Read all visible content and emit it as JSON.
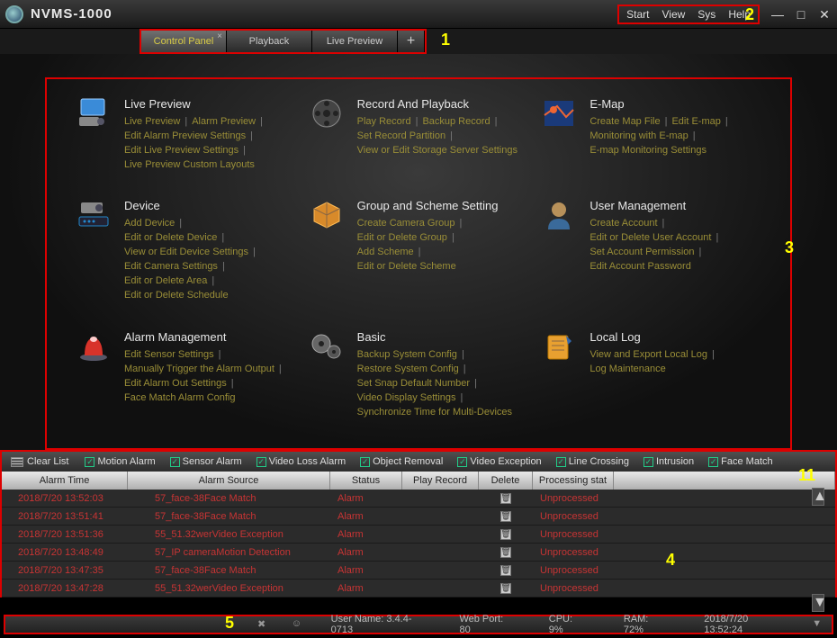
{
  "app_title": "NVMS-1000",
  "top_menu": {
    "start": "Start",
    "view": "View",
    "sys": "Sys",
    "help": "Help"
  },
  "tabs": [
    {
      "label": "Control Panel",
      "active": true,
      "closable": true
    },
    {
      "label": "Playback",
      "active": false,
      "closable": false
    },
    {
      "label": "Live Preview",
      "active": false,
      "closable": false
    }
  ],
  "annots": {
    "a1": "1",
    "a2": "2",
    "a3": "3",
    "a4": "4",
    "a5": "5",
    "a11": "11"
  },
  "modules": {
    "live_preview": {
      "title": "Live Preview",
      "links": [
        "Live Preview",
        "Alarm Preview",
        "Edit Alarm Preview Settings",
        "Edit Live Preview Settings",
        "Live Preview Custom Layouts"
      ]
    },
    "record_playback": {
      "title": "Record And Playback",
      "links": [
        "Play Record",
        "Backup Record",
        "Set Record Partition",
        "View or Edit Storage Server Settings"
      ]
    },
    "emap": {
      "title": "E-Map",
      "links": [
        "Create Map File",
        "Edit E-map",
        "Monitoring with E-map",
        "E-map Monitoring Settings"
      ]
    },
    "device": {
      "title": "Device",
      "links": [
        "Add Device",
        "Edit or Delete Device",
        "View or Edit Device Settings",
        "Edit Camera Settings",
        "Edit or Delete Area",
        "Edit or Delete Schedule"
      ]
    },
    "group_scheme": {
      "title": "Group and Scheme Setting",
      "links": [
        "Create Camera Group",
        "Edit or Delete Group",
        "Add Scheme",
        "Edit or Delete Scheme"
      ]
    },
    "user_mgmt": {
      "title": "User Management",
      "links": [
        "Create Account",
        "Edit or Delete User Account",
        "Set Account Permission",
        "Edit Account Password"
      ]
    },
    "alarm_mgmt": {
      "title": "Alarm Management",
      "links": [
        "Edit Sensor Settings",
        "Manually Trigger the Alarm Output",
        "Edit Alarm Out Settings",
        "Face Match Alarm Config"
      ]
    },
    "basic": {
      "title": "Basic",
      "links": [
        "Backup System Config",
        "Restore System Config",
        "Set Snap Default Number",
        "Video Display Settings",
        "Synchronize Time for Multi-Devices"
      ]
    },
    "local_log": {
      "title": "Local Log",
      "links": [
        "View and Export Local Log",
        "Log Maintenance"
      ]
    }
  },
  "alarm_filters": {
    "clear": "Clear List",
    "items": [
      "Motion Alarm",
      "Sensor Alarm",
      "Video Loss Alarm",
      "Object Removal",
      "Video Exception",
      "Line Crossing",
      "Intrusion",
      "Face Match"
    ]
  },
  "table": {
    "headers": {
      "time": "Alarm Time",
      "source": "Alarm Source",
      "status": "Status",
      "play": "Play Record",
      "del": "Delete",
      "proc": "Processing stat"
    },
    "rows": [
      {
        "time": "2018/7/20 13:52:03",
        "source": "57_face-38Face Match",
        "status": "Alarm",
        "proc": "Unprocessed"
      },
      {
        "time": "2018/7/20 13:51:41",
        "source": "57_face-38Face Match",
        "status": "Alarm",
        "proc": "Unprocessed"
      },
      {
        "time": "2018/7/20 13:51:36",
        "source": "55_51.32werVideo Exception",
        "status": "Alarm",
        "proc": "Unprocessed"
      },
      {
        "time": "2018/7/20 13:48:49",
        "source": "57_IP cameraMotion Detection",
        "status": "Alarm",
        "proc": "Unprocessed"
      },
      {
        "time": "2018/7/20 13:47:35",
        "source": "57_face-38Face Match",
        "status": "Alarm",
        "proc": "Unprocessed"
      },
      {
        "time": "2018/7/20 13:47:28",
        "source": "55_51.32werVideo Exception",
        "status": "Alarm",
        "proc": "Unprocessed"
      }
    ]
  },
  "status": {
    "user_label": "User Name: 3.4.4-0713",
    "web_port": "Web Port: 80",
    "cpu": "CPU: 9%",
    "ram": "RAM: 72%",
    "time": "2018/7/20 13:52:24"
  }
}
